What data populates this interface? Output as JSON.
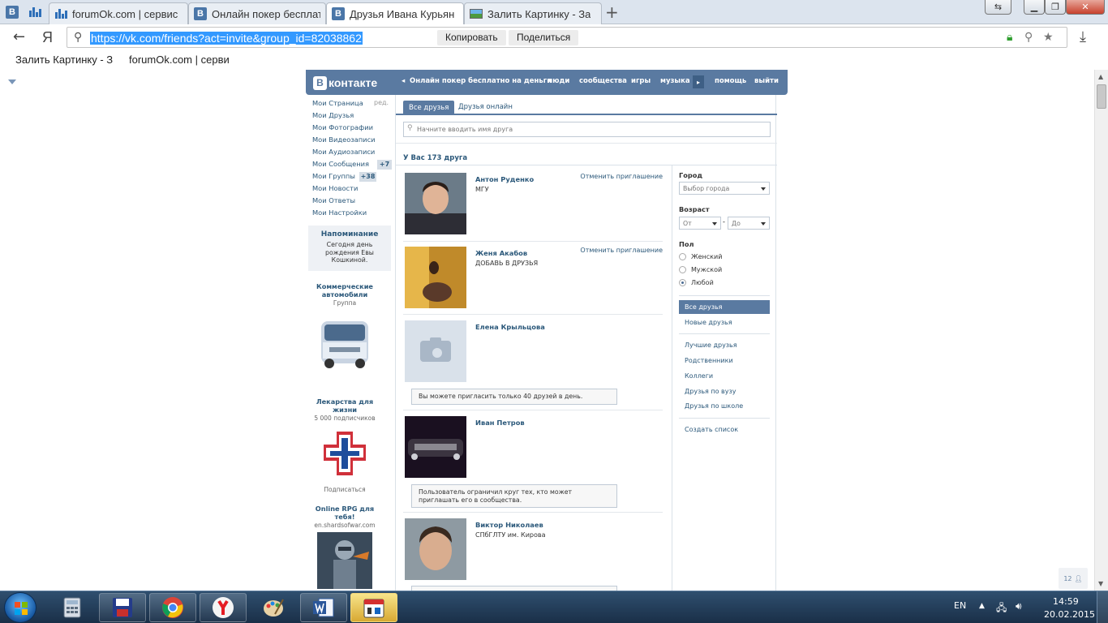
{
  "browser": {
    "tabs": [
      {
        "title": "forumOk.com | сервис"
      },
      {
        "title": "Онлайн покер бесплат"
      },
      {
        "title": "Друзья Ивана Курьян"
      },
      {
        "title": "Залить Картинку - За"
      }
    ],
    "tab_vk_letter": "B",
    "new_tab_symbol": "+",
    "url": "https://vk.com/friends?act=invite&group_id=82038862",
    "copy_button": "Копировать",
    "share_button": "Поделиться",
    "yandex_symbol": "Я",
    "bookmarks": [
      {
        "label": "Залить Картинку - З"
      },
      {
        "label": "forumOk.com | серви"
      }
    ]
  },
  "vk": {
    "logo_letter": "B",
    "logo_text": "контакте",
    "nav": {
      "promo": "Онлайн покер бесплатно на деньги",
      "people": "люди",
      "communities": "сообщества",
      "games": "игры",
      "music": "музыка",
      "help": "помощь",
      "logout": "выйти"
    },
    "left_menu": [
      {
        "label": "Мои Страница"
      },
      {
        "label": "Мои Друзья"
      },
      {
        "label": "Мои Фотографии"
      },
      {
        "label": "Мои Видеозаписи"
      },
      {
        "label": "Мои Аудиозаписи"
      },
      {
        "label": "Мои Сообщения"
      },
      {
        "label": "Мои Группы"
      },
      {
        "label": "Мои Новости"
      },
      {
        "label": "Мои Ответы"
      },
      {
        "label": "Мои Настройки"
      }
    ],
    "edit_label": "ред.",
    "messages_badge": "+7",
    "groups_badge": "+38",
    "reminder": {
      "title": "Напоминание",
      "text": "Сегодня день рождения Евы Кошкиной."
    },
    "ads": [
      {
        "title": "Коммерческие автомобили",
        "subtitle": "Группа"
      },
      {
        "title": "Лекарства для жизни",
        "subtitle": "5 000 подписчиков",
        "action": "Подписаться"
      },
      {
        "title": "Online RPG для тебя!",
        "subtitle": "en.shardsofwar.com"
      }
    ],
    "tabs": {
      "all": "Все друзья",
      "online": "Друзья онлайн"
    },
    "search_placeholder": "Начните вводить имя друга",
    "friends_count": "У Вас 173 друга",
    "friends": [
      {
        "name": "Антон Руденко",
        "subtitle": "МГУ",
        "action": "Отменить приглашение"
      },
      {
        "name": "Женя Акабов",
        "subtitle": "ДОБАВЬ В ДРУЗЬЯ",
        "action": "Отменить приглашение"
      },
      {
        "name": "Елена Крыльцова",
        "notice": "Вы можете пригласить только 40 друзей в день."
      },
      {
        "name": "Иван Петров",
        "notice": "Пользователь ограничил круг тех, кто может приглашать его в сообщества."
      },
      {
        "name": "Виктор Николаев",
        "subtitle": "СПбГЛТУ им. Кирова"
      }
    ],
    "filters": {
      "city_label": "Город",
      "city_select": "Выбор города",
      "age_label": "Возраст",
      "age_from": "От",
      "age_dash": "-",
      "age_to": "До",
      "sex_label": "Пол",
      "sex_options": [
        {
          "label": "Женский",
          "selected": false
        },
        {
          "label": "Мужской",
          "selected": false
        },
        {
          "label": "Любой",
          "selected": true
        }
      ],
      "menu": [
        {
          "label": "Все друзья",
          "selected": true
        },
        {
          "label": "Новые друзья"
        },
        {
          "label": "Лучшие друзья"
        },
        {
          "label": "Родственники"
        },
        {
          "label": "Коллеги"
        },
        {
          "label": "Друзья по вузу"
        },
        {
          "label": "Друзья по школе"
        },
        {
          "label": "Создать список"
        }
      ]
    },
    "page_widget": "12"
  },
  "taskbar": {
    "lang": "EN",
    "time": "14:59",
    "date": "20.02.2015",
    "apps": [
      "calculator-icon",
      "save-disk-icon",
      "chrome-icon",
      "yandex-browser-icon",
      "paint-icon",
      "word-icon",
      "calendar-icon"
    ]
  },
  "colors": {
    "vk_header": "#5a7aa1",
    "vk_link": "#2b587a",
    "url_highlight": "#3399ff",
    "taskbar": "#1a2f48"
  }
}
